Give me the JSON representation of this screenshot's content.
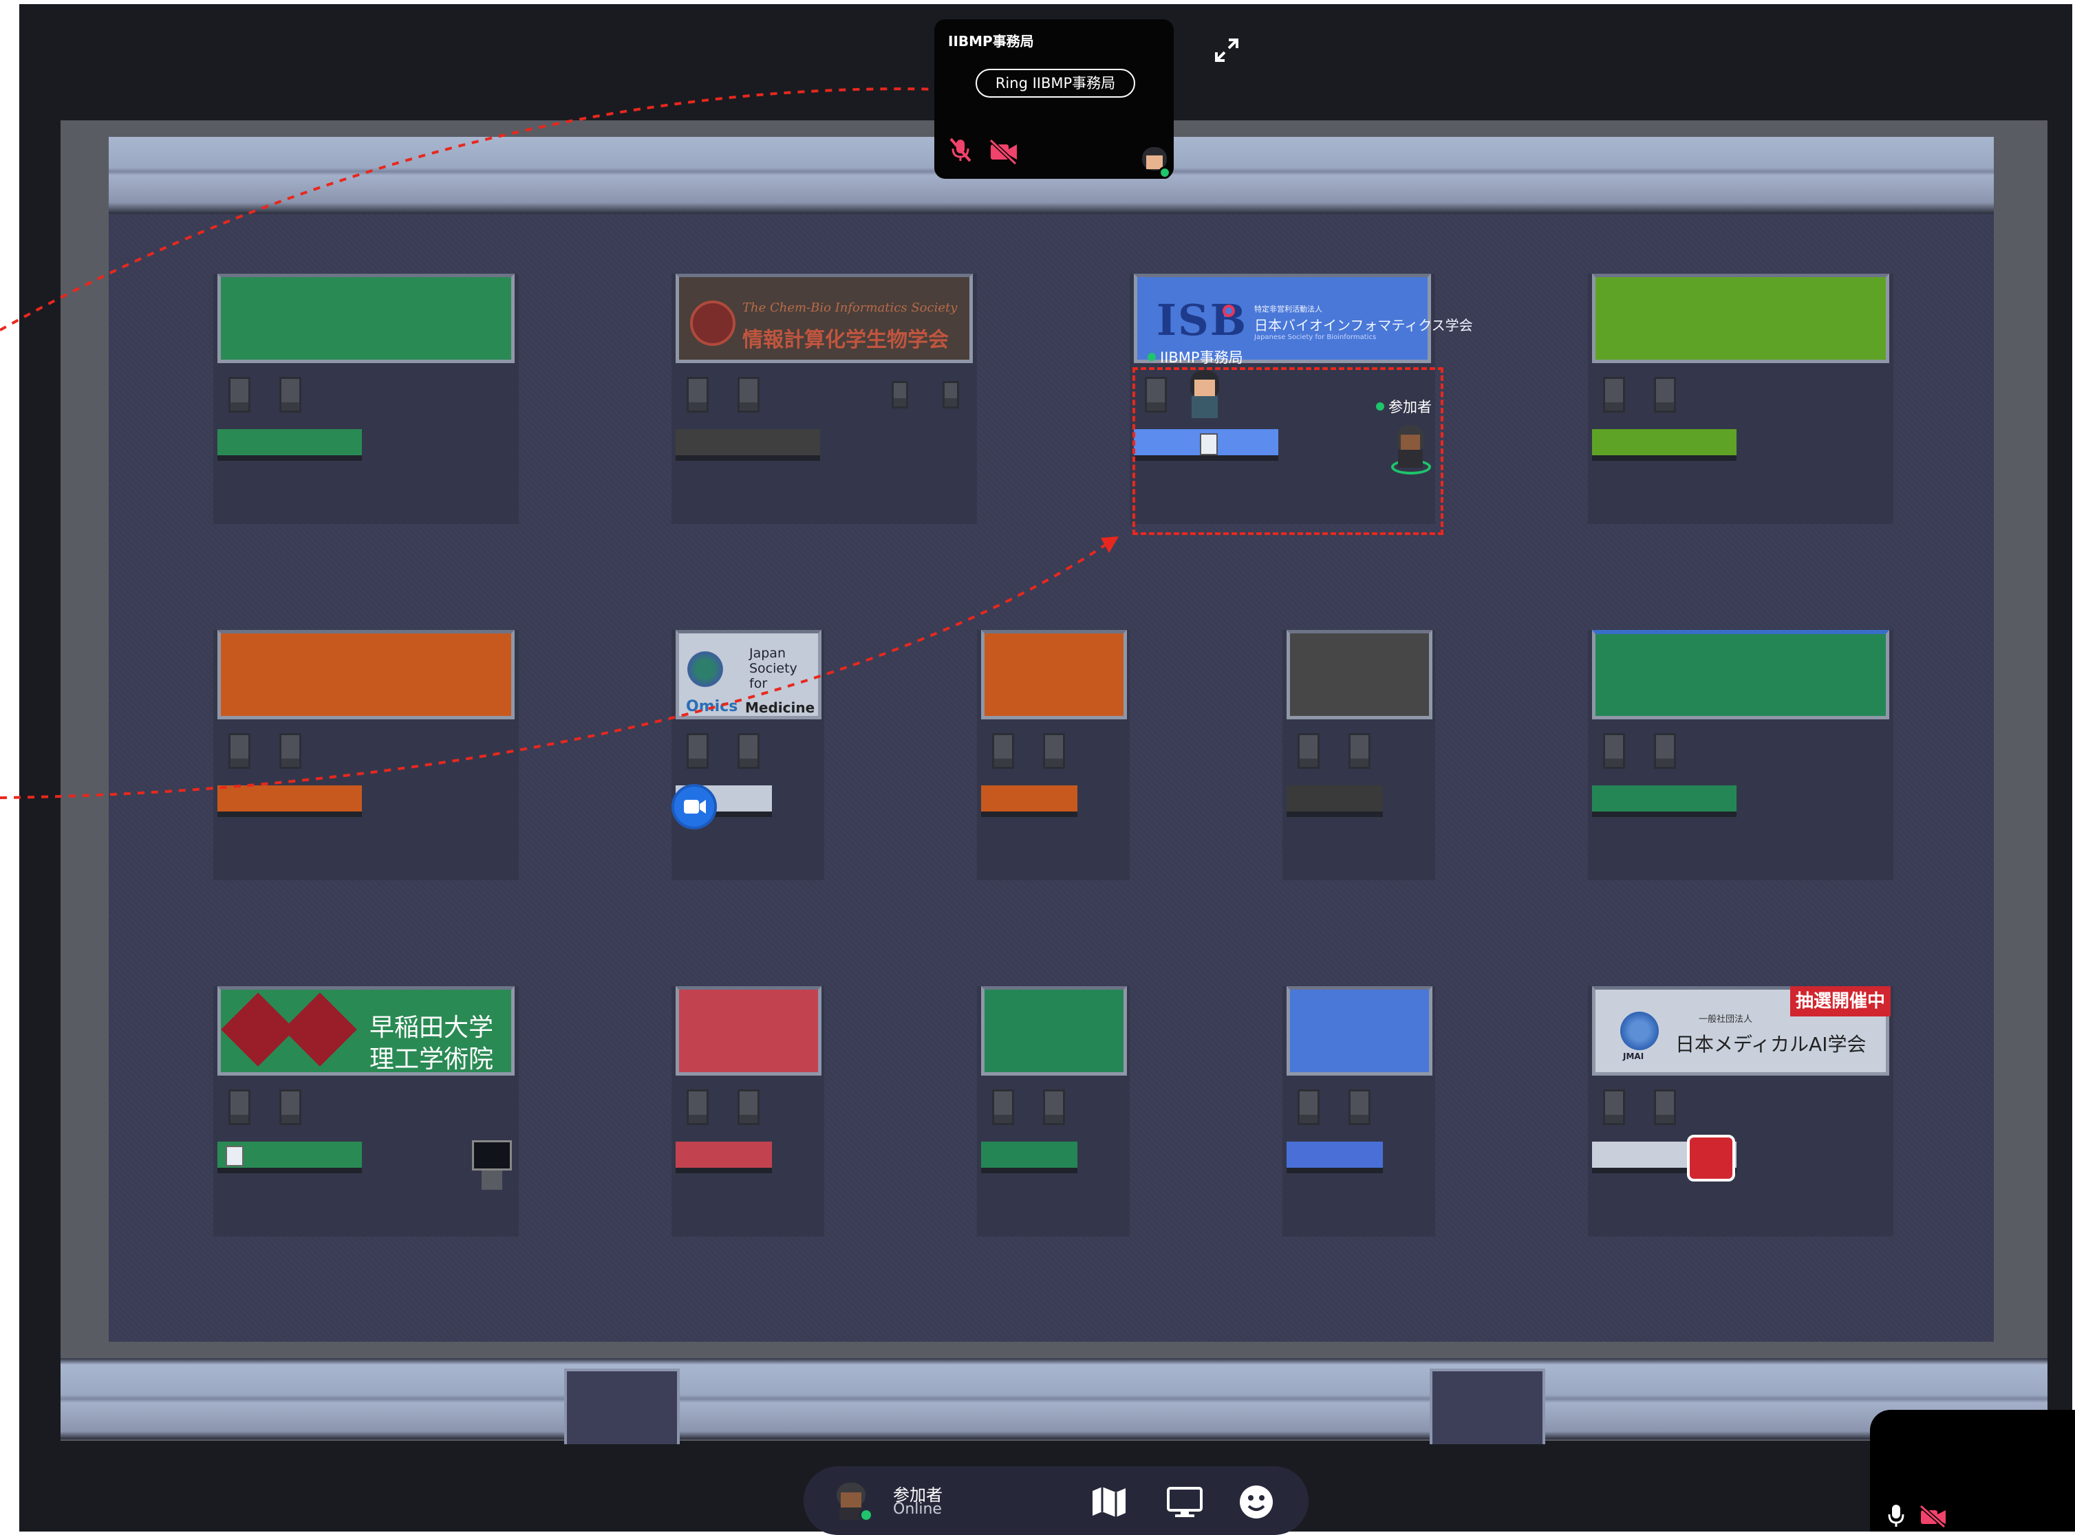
{
  "video_tile": {
    "title": "IIBMP事務局",
    "ring_button_label": "Ring IIBMP事務局",
    "mic_icon": "mic-muted-icon",
    "camera_icon": "camera-off-icon"
  },
  "expand_icon": "expand-icon",
  "booths": {
    "cbi_sign_line1": "The Chem-Bio Informatics Society",
    "cbi_sign_line2": "情報計算化学生物学会",
    "jsbi_sign_logo": "ISB",
    "jsbi_sign_small": "特定非営利活動法人",
    "jsbi_sign_name": "日本バイオインフォマティクス学会",
    "jsbi_sign_english": "Japanese Society for Bioinformatics",
    "omics_sign_line1": "Japan",
    "omics_sign_line2": "Society",
    "omics_sign_line3": "for",
    "omics_sign_line4a": "Omics",
    "omics_sign_line4b": "Medicine",
    "waseda_line1": "早稲田大学",
    "waseda_line2": "理工学術院",
    "jmai_small": "一般社団法人",
    "jmai_name": "日本メディカルAI学会",
    "jmai_logo_text": "JMAI",
    "lottery_badge": "抽選開催中"
  },
  "avatars": {
    "staff_label": "IIBMP事務局",
    "participant_label": "参加者"
  },
  "bottom_bar": {
    "user_name": "参加者",
    "status": "Online",
    "icons": [
      "map-icon",
      "screen-share-icon",
      "emoji-icon"
    ]
  },
  "mini_tile": {
    "icons": [
      "mic-icon",
      "camera-off-icon"
    ]
  },
  "colors": {
    "annotation": "#e8281e",
    "online": "#1fc46b",
    "camera_off": "#f0436b"
  }
}
